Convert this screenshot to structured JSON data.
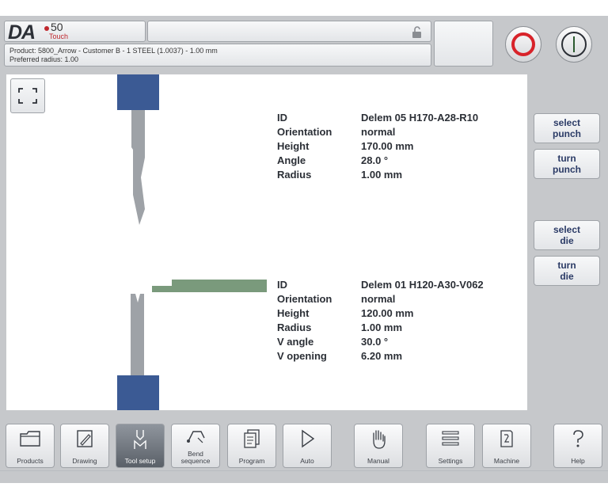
{
  "header": {
    "logo_text": "DA",
    "logo_number": "50",
    "logo_touch": "Touch",
    "product_line": "Product: 5800_Arrow - Customer B - 1 STEEL (1.0037) - 1.00 mm",
    "radius_line": "Preferred radius: 1.00"
  },
  "punch": {
    "labels": [
      "ID",
      "Orientation",
      "Height",
      "Angle",
      "Radius"
    ],
    "values": [
      "Delem 05 H170-A28-R10",
      "normal",
      "170.00 mm",
      "28.0 °",
      "1.00 mm"
    ]
  },
  "die": {
    "labels": [
      "ID",
      "Orientation",
      "Height",
      "Radius",
      "V angle",
      "V opening"
    ],
    "values": [
      "Delem 01 H120-A30-V062",
      "normal",
      "120.00 mm",
      "1.00 mm",
      "30.0 °",
      "6.20 mm"
    ]
  },
  "side_buttons": {
    "select_punch": [
      "select",
      "punch"
    ],
    "turn_punch": [
      "turn",
      "punch"
    ],
    "select_die": [
      "select",
      "die"
    ],
    "turn_die": [
      "turn",
      "die"
    ]
  },
  "taskbar": [
    {
      "label": "Products",
      "icon": "folder-icon"
    },
    {
      "label": "Drawing",
      "icon": "pencil-icon"
    },
    {
      "label": "Tool setup",
      "icon": "tool-icon",
      "active": true
    },
    {
      "label": "Bend sequence",
      "icon": "bend-sequence-icon"
    },
    {
      "label": "Program",
      "icon": "program-icon"
    },
    {
      "label": "Auto",
      "icon": "play-icon"
    },
    {
      "label": "Manual",
      "icon": "hand-icon"
    },
    {
      "label": "Settings",
      "icon": "list-icon"
    },
    {
      "label": "Machine",
      "icon": "machine-icon"
    },
    {
      "label": "Help",
      "icon": "help-icon"
    }
  ],
  "colors": {
    "tool_block": "#3b5a94",
    "tool_body": "#9ea2a7",
    "sheet": "#7a9a7c",
    "stop": "#d8232a",
    "label_blue": "#2b3b66"
  }
}
